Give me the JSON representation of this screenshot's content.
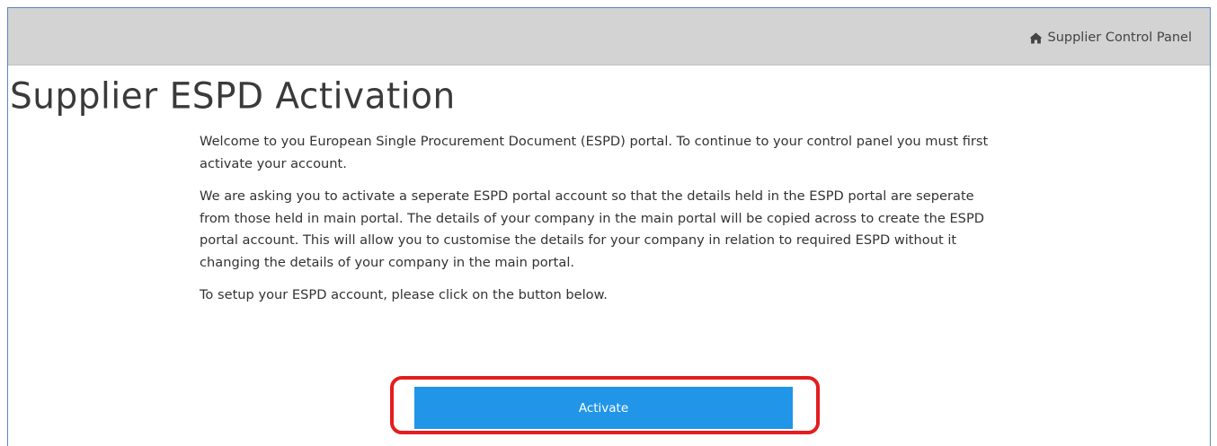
{
  "nav": {
    "control_panel_label": "Supplier Control Panel",
    "control_panel_icon": "home-icon"
  },
  "page": {
    "title": "Supplier ESPD Activation"
  },
  "content": {
    "paragraphs": [
      "Welcome to you European Single Procurement Document (ESPD) portal. To continue to your control panel you must first activate your account.",
      "We are asking you to activate a seperate ESPD portal account so that the details held in the ESPD portal are seperate from those held in main portal. The details of your company in the main portal will be copied across to create the ESPD portal account. This will allow you to customise the details for your company in relation to required ESPD without it changing the details of your company in the main portal.",
      "To setup your ESPD account, please click on the button below."
    ]
  },
  "actions": {
    "activate_label": "Activate"
  },
  "colors": {
    "topbar_bg": "#d3d3d3",
    "button_bg": "#2196e8",
    "highlight_border": "#e41d1d",
    "frame_border": "#5b86c5"
  }
}
